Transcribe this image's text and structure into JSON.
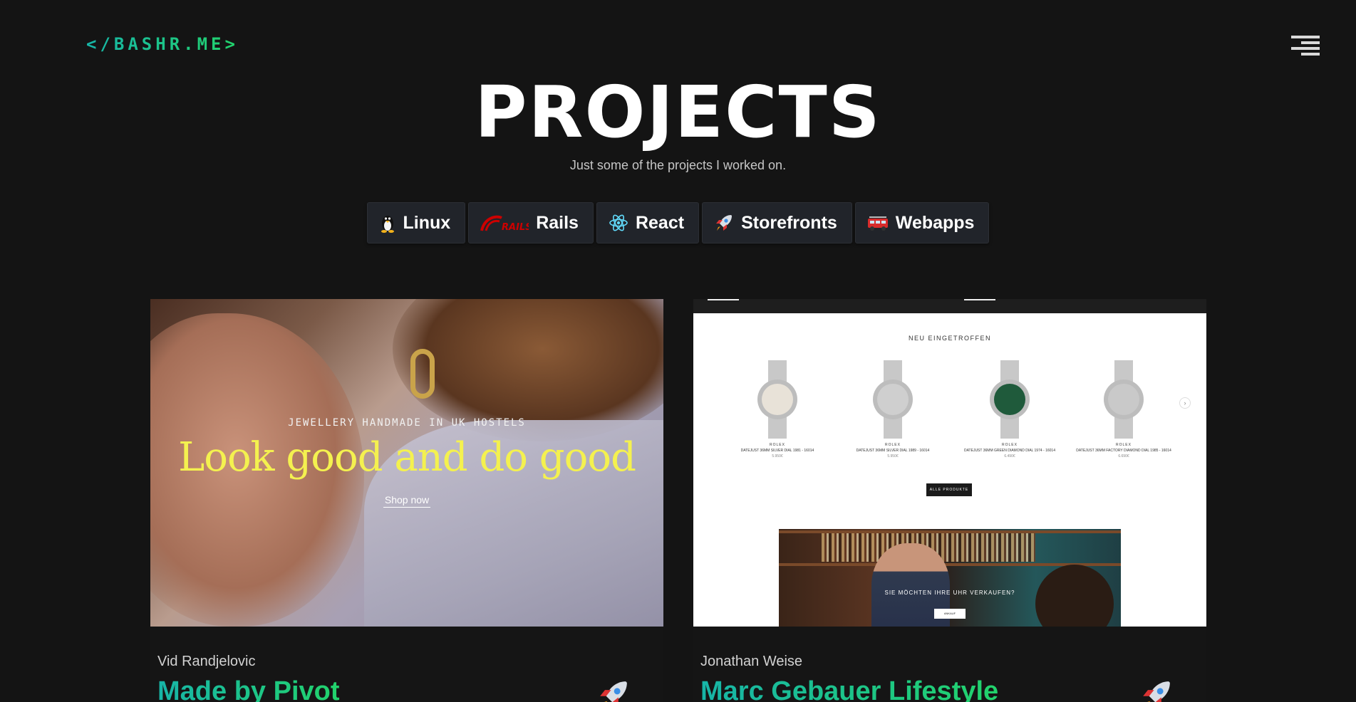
{
  "header": {
    "logo": "</BASHR.ME>",
    "menu_icon": "hamburger-menu-icon"
  },
  "hero": {
    "title": "PROJECTS",
    "subtitle": "Just some of the projects I worked on."
  },
  "filters": [
    {
      "label": "Linux",
      "icon": "tux-penguin-icon"
    },
    {
      "label": "Rails",
      "icon": "rails-logo-icon"
    },
    {
      "label": "React",
      "icon": "react-atom-icon"
    },
    {
      "label": "Storefronts",
      "icon": "rocket-icon"
    },
    {
      "label": "Webapps",
      "icon": "fire-truck-icon"
    }
  ],
  "projects": [
    {
      "author": "Vid Randjelovic",
      "title": "Made by Pivot",
      "badge_icon": "rocket-icon",
      "screenshot": {
        "eyebrow": "JEWELLERY HANDMADE IN UK HOSTELS",
        "headline": "Look good and do good",
        "cta": "Shop now"
      }
    },
    {
      "author": "Jonathan Weise",
      "title": "Marc Gebauer Lifestyle",
      "badge_icon": "rocket-icon",
      "screenshot": {
        "section_title": "NEU EINGETROFFEN",
        "watches": [
          {
            "brand": "ROLEX",
            "model": "DATEJUST 36MM SILVER DIAL 1981 - 16014",
            "price": "5.950€",
            "dial": "#e8e2d8"
          },
          {
            "brand": "ROLEX",
            "model": "DATEJUST 36MM SILVER DIAL 1989 - 16014",
            "price": "5.950€",
            "dial": "#cfcfcf"
          },
          {
            "brand": "ROLEX",
            "model": "DATEJUST 36MM GREEN DIAMOND DIAL 1974 - 16014",
            "price": "6.490€",
            "dial": "#1f5a3b"
          },
          {
            "brand": "ROLEX",
            "model": "DATEJUST 36MM FACTORY DIAMOND DIAL 1985 - 16014",
            "price": "6.690€",
            "dial": "#c9c9c9"
          }
        ],
        "all_products": "ALLE PRODUKTE",
        "sell_text": "SIE MÖCHTEN IHRE UHR VERKAUFEN?",
        "sell_button": "ANKAUF"
      }
    }
  ],
  "colors": {
    "background": "#141414",
    "accent_start": "#17b5a8",
    "accent_end": "#22d36b",
    "chip_bg": "#21242a",
    "headline_yellow": "#f4f14f"
  }
}
